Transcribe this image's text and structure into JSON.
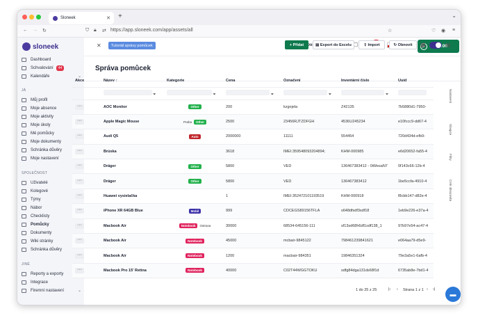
{
  "browser": {
    "tab_title": "Sloneek",
    "url": "https://app.sloneek.com/app/assets/all"
  },
  "sidebar": {
    "logo": "sloneek",
    "main_items": [
      {
        "label": "Dashboard"
      },
      {
        "label": "Schvalování",
        "badge": "44"
      },
      {
        "label": "Kalendáře"
      }
    ],
    "section_me": "JÁ",
    "me_items": [
      {
        "label": "Můj profil"
      },
      {
        "label": "Moje absence"
      },
      {
        "label": "Moje aktivity"
      },
      {
        "label": "Moje úkoly"
      },
      {
        "label": "Mé pomůcky"
      },
      {
        "label": "Moje dokumenty"
      },
      {
        "label": "Schránka důvěry"
      },
      {
        "label": "Moje nastavení"
      }
    ],
    "section_company": "SPOLEČNOST",
    "company_items": [
      {
        "label": "Uživatelé"
      },
      {
        "label": "Kolegové"
      },
      {
        "label": "Týmy"
      },
      {
        "label": "Nábor"
      },
      {
        "label": "Checklisty"
      },
      {
        "label": "Pomůcky"
      },
      {
        "label": "Dokumenty"
      },
      {
        "label": "Wiki stránky"
      },
      {
        "label": "Schránka důvěry"
      }
    ],
    "section_other": "JINÉ",
    "other_items": [
      {
        "label": "Reporty a exporty"
      },
      {
        "label": "Integrace"
      },
      {
        "label": "Firemní nastavení"
      }
    ]
  },
  "topbar": {
    "tutorial_label": "Tutoriál správy pomůcek",
    "new_nav_label": "Nová navigace",
    "notification_count": "1",
    "timer": "00:00:00"
  },
  "page": {
    "title": "Správa pomůcek",
    "add_label": "Přidat",
    "export_label": "Export do Excelu",
    "import_label": "Import",
    "refresh_label": "Obnovit"
  },
  "table": {
    "columns": [
      "Akce",
      "Název",
      "Kategorie",
      "Cena",
      "Označení",
      "Inventární číslo",
      "Uuid"
    ],
    "rows": [
      {
        "name": "AOC Monitor",
        "pre": "",
        "tag": "Other",
        "tagColor": "#22b14c",
        "post": "",
        "price": "200",
        "mark": "kzgojela",
        "inv": "Z42135",
        "uuid": "7b5880d1-7950-"
      },
      {
        "name": "Apple Magic Mouse",
        "pre": "Praha",
        "tag": "Other",
        "tagColor": "#22b14c",
        "post": "",
        "price": "2500",
        "mark": "23456RJTZDFGH",
        "inv": "4536U245234",
        "uuid": "e10fccc9-dd67-4"
      },
      {
        "name": "Audi Q5",
        "pre": "",
        "tag": "Auto",
        "tagColor": "#c0272d",
        "post": "",
        "price": "2000000",
        "mark": "11111",
        "inv": "554454",
        "uuid": "720d434d-efb9-"
      },
      {
        "name": "Brúska",
        "pre": "",
        "tag": "",
        "tagColor": "",
        "post": "",
        "price": "3618",
        "mark": "IMEI:359548093204894;",
        "inv": "KHM-000985",
        "uuid": "e6d20652-fa55-4"
      },
      {
        "name": "Dräger",
        "pre": "",
        "tag": "Other",
        "tagColor": "#22b14c",
        "post": "",
        "price": "5800",
        "mark": "VED",
        "inv": "136467383412 - 0iWesaN7",
        "uuid": "0f143c66-12b-4"
      },
      {
        "name": "Dräger",
        "pre": "",
        "tag": "Other",
        "tagColor": "#22b14c",
        "post": "",
        "price": "5800",
        "mark": "VED",
        "inv": "136467383412",
        "uuid": "1be5ccfa-4910-4"
      },
      {
        "name": "Huawei vysielačka",
        "pre": "",
        "tag": "",
        "tagColor": "",
        "post": "",
        "price": "1",
        "mark": "IMEI:352472101193519",
        "inv": "KHM-000918",
        "uuid": "f8cbb147-d82e-4"
      },
      {
        "name": "iPhone XR 64GB Blue",
        "pre": "",
        "tag": "Mobil",
        "tagColor": "#3a2fa8",
        "post": "",
        "price": "999",
        "mark": "CDCEGS89156TFLA",
        "inv": "s648dfsdf3sdf18",
        "uuid": "1eb9e226-e37a-4"
      },
      {
        "name": "Macbook Air",
        "pre": "",
        "tag": "Notebook",
        "tagColor": "#e0245e",
        "post": "Ostrava",
        "price": "30000",
        "mark": "68534-645156-111",
        "inv": "sf13sd68h6df1sdf138_1",
        "uuid": "97b97e54-ac47-4"
      },
      {
        "name": "Macbook Air",
        "pre": "",
        "tag": "Notebook",
        "tagColor": "#e0245e",
        "post": "",
        "price": "45000",
        "mark": "mcbair-9845122",
        "inv": "798461239841621",
        "uuid": "e064aa79-d5e9-"
      },
      {
        "name": "Macbook Air",
        "pre": "",
        "tag": "Notebook",
        "tagColor": "#e0245e",
        "post": "",
        "price": "1200",
        "mark": "macbair-984351",
        "inv": "19846351324",
        "uuid": "79e3a5e1-6afb-4"
      },
      {
        "name": "Macbook Pro 15' Retina",
        "pre": "",
        "tag": "Notebook",
        "tagColor": "#e0245e",
        "post": "",
        "price": "40000",
        "mark": "C02T44WGGTOKU",
        "inv": "sdfg84dga131ds68f1d",
        "uuid": "6735ab8e-7bd1-4"
      }
    ]
  },
  "right_tabs": [
    "Nastavení",
    "Sloupce",
    "Filtry",
    "Celé obrazovka"
  ],
  "pagination": {
    "range": "1 do 25 z 25",
    "page_label": "Strana 1 z 1"
  }
}
